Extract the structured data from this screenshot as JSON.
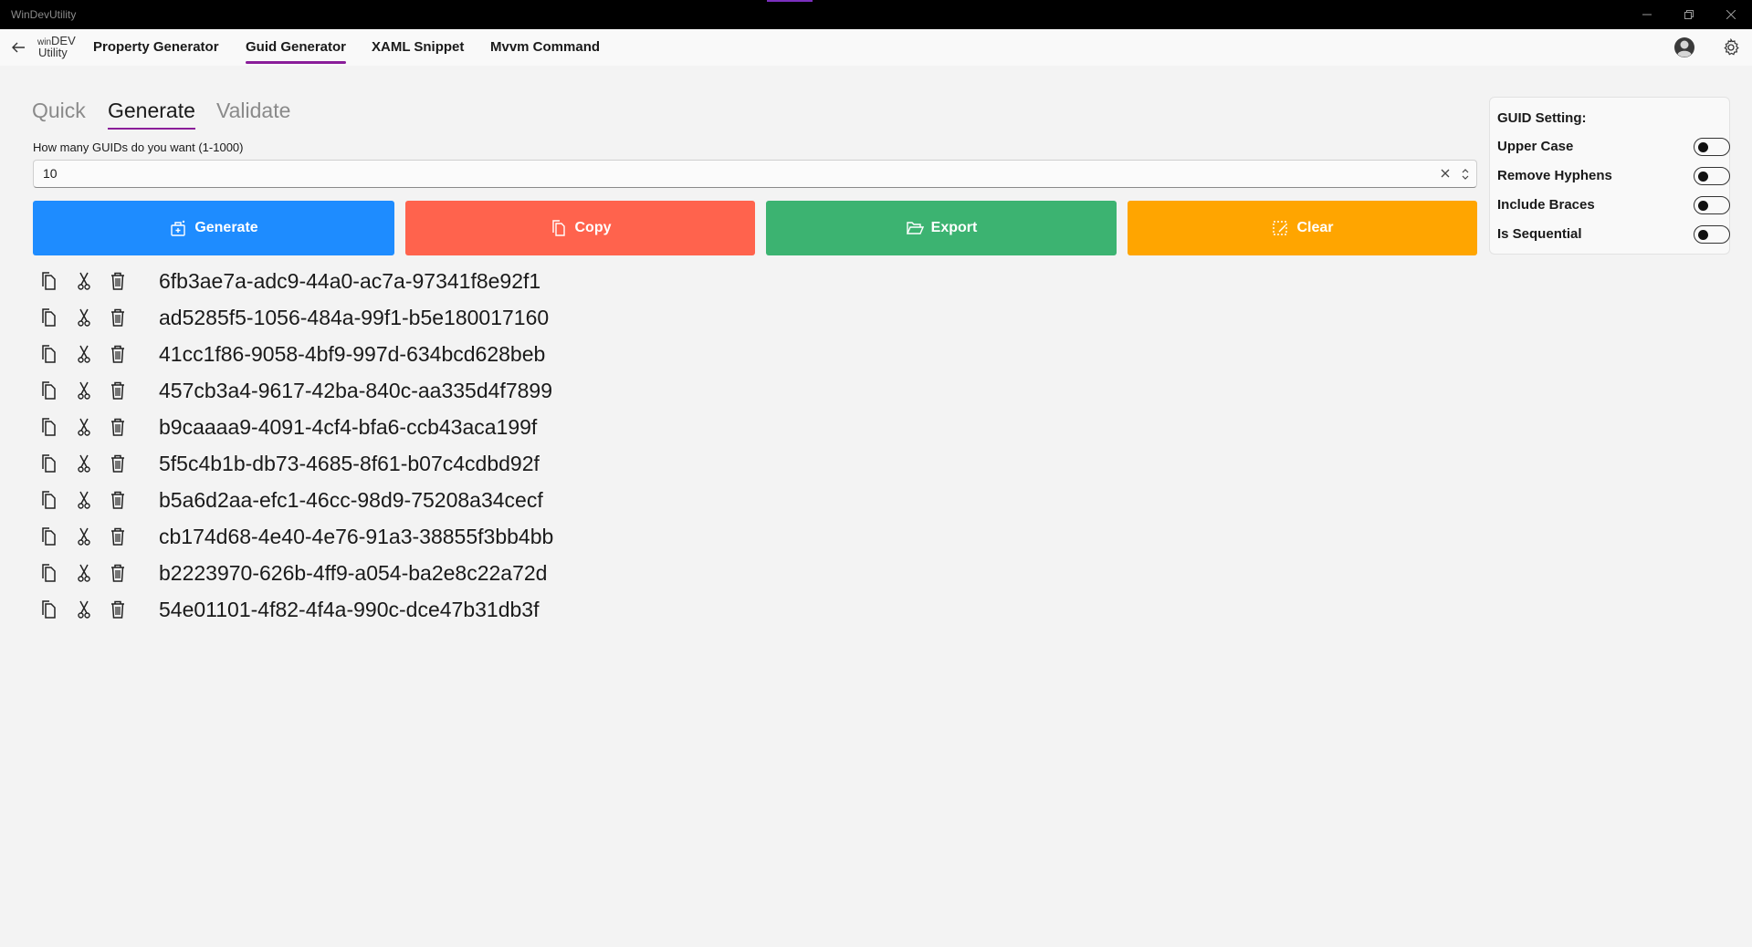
{
  "window": {
    "title": "WinDevUtility"
  },
  "logo": {
    "line1_small": "win",
    "line1_big": "DEV",
    "line2": "Utility"
  },
  "nav": {
    "items": [
      {
        "label": "Property Generator",
        "active": false
      },
      {
        "label": "Guid Generator",
        "active": true
      },
      {
        "label": "XAML Snippet",
        "active": false
      },
      {
        "label": "Mvvm Command",
        "active": false
      }
    ]
  },
  "tabs": [
    {
      "label": "Quick",
      "active": false
    },
    {
      "label": "Generate",
      "active": true
    },
    {
      "label": "Validate",
      "active": false
    }
  ],
  "count_field": {
    "label": "How many GUIDs do you want (1-1000)",
    "value": "10"
  },
  "actions": {
    "generate": "Generate",
    "copy": "Copy",
    "export": "Export",
    "clear": "Clear"
  },
  "colors": {
    "generate": "#1e8cff",
    "copy": "#ff634d",
    "export": "#3cb371",
    "clear": "#ffa500",
    "accent": "#8a1d99"
  },
  "guids": [
    "6fb3ae7a-adc9-44a0-ac7a-97341f8e92f1",
    "ad5285f5-1056-484a-99f1-b5e180017160",
    "41cc1f86-9058-4bf9-997d-634bcd628beb",
    "457cb3a4-9617-42ba-840c-aa335d4f7899",
    "b9caaaa9-4091-4cf4-bfa6-ccb43aca199f",
    "5f5c4b1b-db73-4685-8f61-b07c4cdbd92f",
    "b5a6d2aa-efc1-46cc-98d9-75208a34cecf",
    "cb174d68-4e40-4e76-91a3-38855f3bb4bb",
    "b2223970-626b-4ff9-a054-ba2e8c22a72d",
    "54e01101-4f82-4f4a-990c-dce47b31db3f"
  ],
  "settings": {
    "title": "GUID Setting:",
    "options": [
      {
        "label": "Upper Case",
        "on": false
      },
      {
        "label": "Remove Hyphens",
        "on": false
      },
      {
        "label": "Include Braces",
        "on": false
      },
      {
        "label": "Is Sequential",
        "on": false
      }
    ]
  },
  "icons": {
    "row": [
      "copy-icon",
      "cut-icon",
      "delete-icon"
    ]
  }
}
